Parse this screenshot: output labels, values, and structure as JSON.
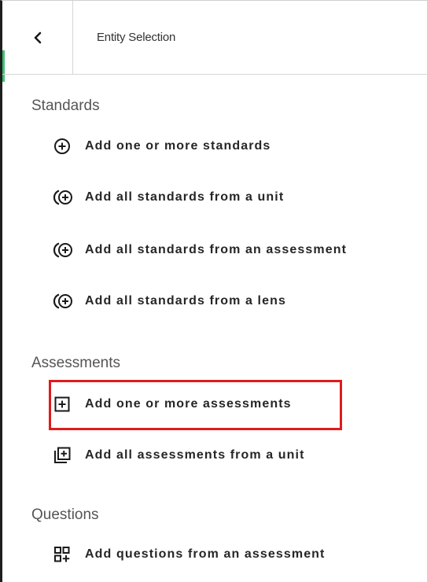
{
  "header": {
    "back_icon": "chevron-left-icon",
    "title": "Entity Selection"
  },
  "sections": {
    "standards": {
      "title": "Standards",
      "items": [
        {
          "label": "Add one or more standards",
          "icon": "circle-plus-icon"
        },
        {
          "label": "Add all standards from a unit",
          "icon": "circle-plus-multiple-icon"
        },
        {
          "label": "Add all standards from an assessment",
          "icon": "circle-plus-multiple-icon"
        },
        {
          "label": "Add all standards from a lens",
          "icon": "circle-plus-multiple-icon"
        }
      ]
    },
    "assessments": {
      "title": "Assessments",
      "items": [
        {
          "label": "Add one or more assessments",
          "icon": "square-plus-icon"
        },
        {
          "label": "Add all assessments from a unit",
          "icon": "library-add-icon"
        }
      ]
    },
    "questions": {
      "title": "Questions",
      "items": [
        {
          "label": "Add questions from an assessment",
          "icon": "grid-plus-icon"
        }
      ]
    }
  },
  "colors": {
    "highlight": "#e01b1b",
    "accent": "#3fbf74",
    "text": "#262626",
    "section_title": "#555555"
  }
}
